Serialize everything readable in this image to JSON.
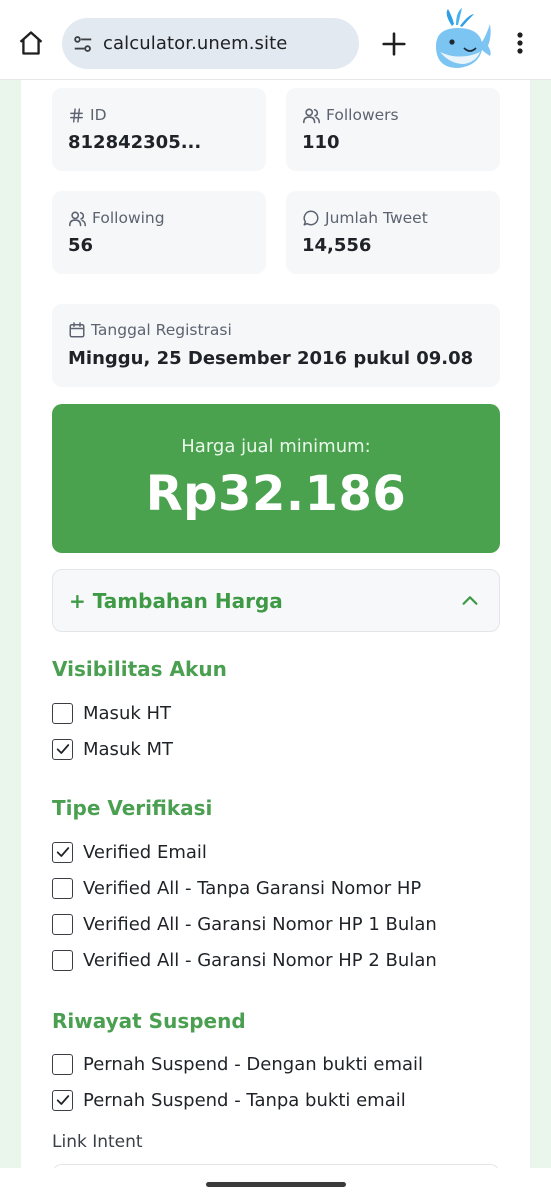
{
  "browser": {
    "url": "calculator.unem.site",
    "home_icon": "home-icon",
    "site_settings_icon": "tune-icon",
    "new_tab_icon": "plus-icon",
    "menu_icon": "more-vert-icon",
    "avatar_icon": "whale-avatar"
  },
  "stats": {
    "id_label": "ID",
    "id_value": "812842305...",
    "followers_label": "Followers",
    "followers_value": "110",
    "following_label": "Following",
    "following_value": "56",
    "tweets_label": "Jumlah Tweet",
    "tweets_value": "14,556",
    "registration_label": "Tanggal Registrasi",
    "registration_value": "Minggu, 25 Desember 2016 pukul 09.08"
  },
  "price": {
    "label": "Harga jual minimum:",
    "value": "Rp32.186"
  },
  "accordion": {
    "title": "+ Tambahan Harga"
  },
  "visibility": {
    "title": "Visibilitas Akun",
    "options": [
      {
        "label": "Masuk HT",
        "checked": false
      },
      {
        "label": "Masuk MT",
        "checked": true
      }
    ]
  },
  "verification": {
    "title": "Tipe Verifikasi",
    "options": [
      {
        "label": "Verified Email",
        "checked": true
      },
      {
        "label": "Verified All - Tanpa Garansi Nomor HP",
        "checked": false
      },
      {
        "label": "Verified All - Garansi Nomor HP 1 Bulan",
        "checked": false
      },
      {
        "label": "Verified All - Garansi Nomor HP 2 Bulan",
        "checked": false
      }
    ]
  },
  "suspend": {
    "title": "Riwayat Suspend",
    "options": [
      {
        "label": "Pernah Suspend - Dengan bukti email",
        "checked": false
      },
      {
        "label": "Pernah Suspend - Tanpa bukti email",
        "checked": true
      }
    ]
  },
  "link_intent": {
    "label": "Link Intent"
  },
  "colors": {
    "accent_green": "#4aa24f",
    "section_green": "#4a9f50"
  }
}
